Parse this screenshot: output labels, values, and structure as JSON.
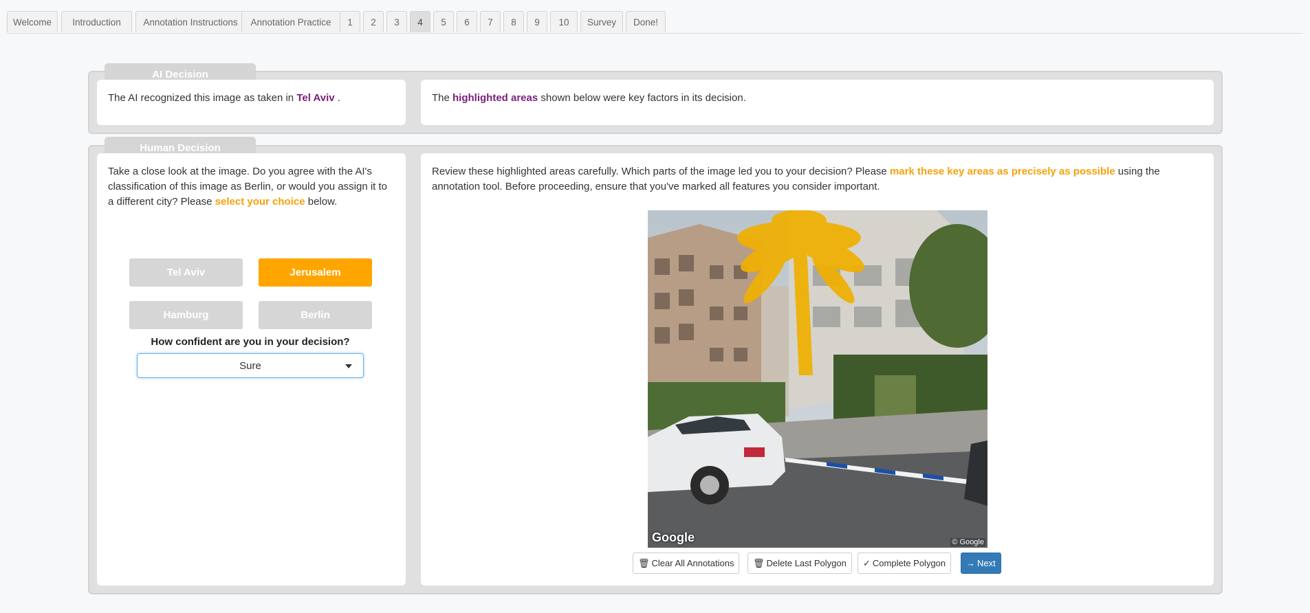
{
  "tabs": [
    {
      "label": "Welcome",
      "active": false
    },
    {
      "label": "Introduction",
      "active": false
    },
    {
      "label": "Annotation Instructions",
      "active": false
    },
    {
      "label": "Annotation Practice",
      "active": false
    },
    {
      "label": "1",
      "active": false
    },
    {
      "label": "2",
      "active": false
    },
    {
      "label": "3",
      "active": false
    },
    {
      "label": "4",
      "active": true
    },
    {
      "label": "5",
      "active": false
    },
    {
      "label": "6",
      "active": false
    },
    {
      "label": "7",
      "active": false
    },
    {
      "label": "8",
      "active": false
    },
    {
      "label": "9",
      "active": false
    },
    {
      "label": "10",
      "active": false
    },
    {
      "label": "Survey",
      "active": false
    },
    {
      "label": "Done!",
      "active": false
    }
  ],
  "ai_section": {
    "label": "AI Decision",
    "left_text_prefix": "The AI recognized this image as taken in ",
    "left_city": "Tel Aviv",
    "left_text_suffix": " .",
    "right_prefix": "The ",
    "right_highlight": "highlighted areas",
    "right_suffix": " shown below were key factors in its decision."
  },
  "human_section": {
    "label": "Human Decision",
    "prompt_part1": "Take a close look at the image. Do you agree with the AI's classification of this image as Berlin, or would you assign it to a different city? Please ",
    "prompt_highlight": "select your choice",
    "prompt_part2": " below.",
    "choices": [
      {
        "label": "Tel Aviv",
        "selected": false
      },
      {
        "label": "Jerusalem",
        "selected": true
      },
      {
        "label": "Hamburg",
        "selected": false
      },
      {
        "label": "Berlin",
        "selected": false
      }
    ],
    "confidence_question": "How confident are you in your decision?",
    "confidence_value": "Sure",
    "review_part1": "Review these highlighted areas carefully. Which parts of the image led you to your decision? Please ",
    "review_highlight": "mark these key areas as precisely as possible",
    "review_part2": " using the annotation tool. Before proceeding, ensure that you've marked all features you consider important."
  },
  "image": {
    "watermark_left": "Google",
    "watermark_right": "© Google"
  },
  "toolbar": {
    "clear_label": "Clear All Annotations",
    "delete_label": "Delete Last Polygon",
    "complete_label": "Complete Polygon",
    "next_label": "Next"
  },
  "colors": {
    "purple": "#7a1f7a",
    "orange": "#f5a20a",
    "selected_choice": "#ffa500",
    "primary_button": "#337ab7"
  }
}
